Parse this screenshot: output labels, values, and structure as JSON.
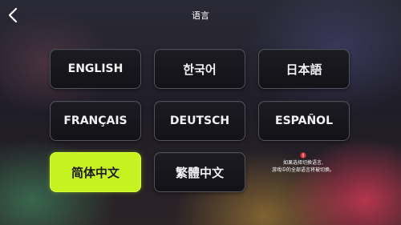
{
  "header": {
    "title": "语言"
  },
  "languages": [
    {
      "label": "ENGLISH"
    },
    {
      "label": "한국어"
    },
    {
      "label": "日本語"
    },
    {
      "label": "FRANÇAIS"
    },
    {
      "label": "DEUTSCH"
    },
    {
      "label": "ESPAÑOL"
    },
    {
      "label": "简体中文"
    },
    {
      "label": "繁體中文"
    }
  ],
  "selected_language": "简体中文",
  "hint": {
    "line1": "如果选择切换语言,",
    "line2": "游戏中的全部语言将被切换。"
  },
  "icons": {
    "back": "chevron-left-icon",
    "warning": "warning-icon"
  },
  "colors": {
    "accent": "#c6f31f",
    "warning": "#e03030"
  }
}
